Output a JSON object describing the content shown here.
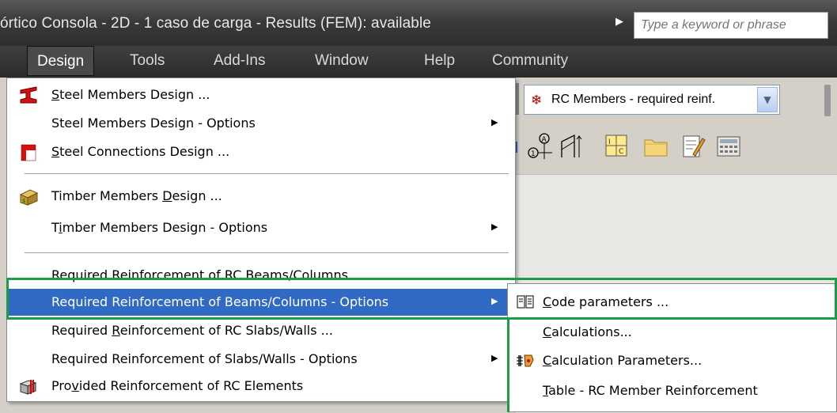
{
  "titlebar": {
    "title": "órtico Consola - 2D - 1 caso de carga - Results (FEM): available",
    "search_placeholder": "Type a keyword or phrase"
  },
  "menubar": {
    "items": [
      "Design",
      "Tools",
      "Add-Ins",
      "Window",
      "Help",
      "Community"
    ]
  },
  "toolbar": {
    "combo_text": "RC Members - required reinf."
  },
  "design_menu": {
    "items": [
      {
        "pre": "",
        "ul": "S",
        "post": "teel Members Design ..."
      },
      {
        "pre": "Steel Members Design - Options",
        "ul": "",
        "post": ""
      },
      {
        "pre": "",
        "ul": "S",
        "post": "teel Connections Design ..."
      },
      {
        "pre": "Timber Members ",
        "ul": "D",
        "post": "esign ..."
      },
      {
        "pre": "T",
        "ul": "i",
        "post": "mber Members Design - Options"
      },
      {
        "pre": "Required Reinforcement of RC Beams/Columns ...",
        "ul": "",
        "post": ""
      },
      {
        "pre": "Required Reinforcement of Beams/Columns - Options",
        "ul": "",
        "post": ""
      },
      {
        "pre": "Required ",
        "ul": "R",
        "post": "einforcement of RC Slabs/Walls ..."
      },
      {
        "pre": "Required Reinforcement of Slabs/Walls - Options",
        "ul": "",
        "post": ""
      },
      {
        "pre": "Pro",
        "ul": "v",
        "post": "ided Reinforcement of RC Elements"
      }
    ]
  },
  "submenu": {
    "items": [
      {
        "ul": "C",
        "post": "ode parameters ..."
      },
      {
        "ul": "C",
        "post": "alculations..."
      },
      {
        "ul": "C",
        "post": "alculation Parameters..."
      },
      {
        "ul": "T",
        "post": "able - RC Member Reinforcement"
      }
    ]
  },
  "colors": {
    "highlight": "#316ac5",
    "annotation_green": "#1c9c47"
  }
}
